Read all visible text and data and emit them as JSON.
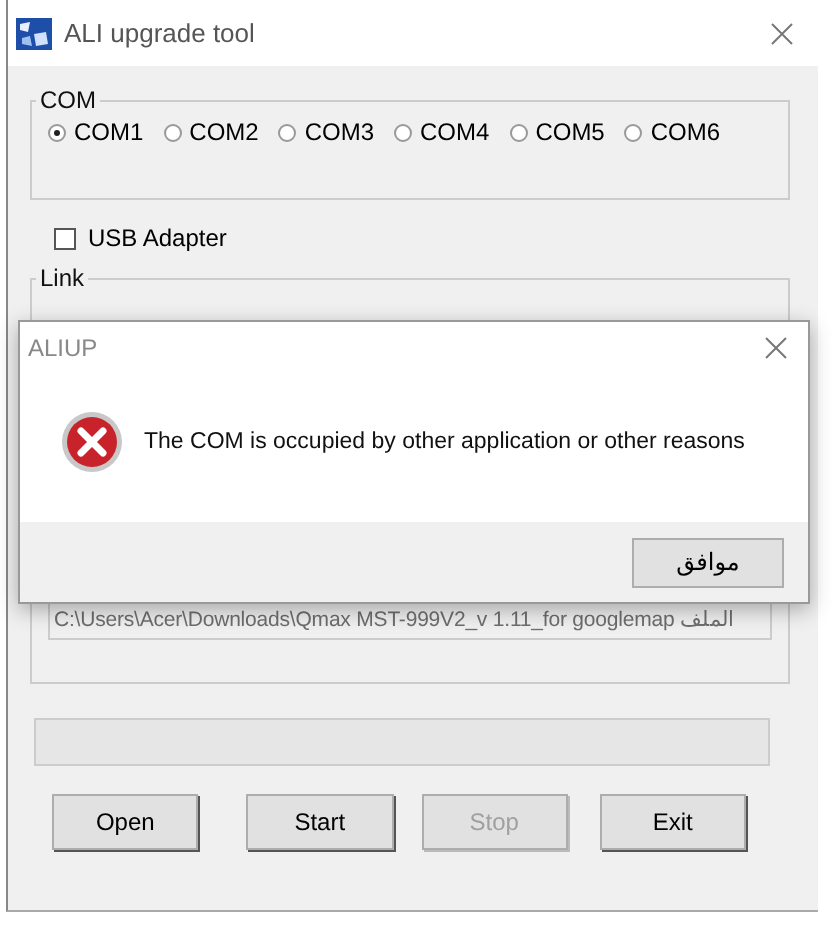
{
  "window": {
    "title": "ALI upgrade tool"
  },
  "com_group": {
    "label": "COM",
    "ports": [
      {
        "label": "COM1",
        "selected": true
      },
      {
        "label": "COM2",
        "selected": false
      },
      {
        "label": "COM3",
        "selected": false
      },
      {
        "label": "COM4",
        "selected": false
      },
      {
        "label": "COM5",
        "selected": false
      },
      {
        "label": "COM6",
        "selected": false
      }
    ]
  },
  "usb_adapter": {
    "label": "USB Adapter",
    "checked": false
  },
  "link_group": {
    "label": "Link",
    "file_path": {
      "value": "C:\\Users\\Acer\\Downloads\\Qmax MST-999V2_v 1.11_for googlemap الملف",
      "disabled": true
    }
  },
  "buttons": [
    {
      "label": "Open",
      "disabled": false
    },
    {
      "label": "Start",
      "disabled": false
    },
    {
      "label": "Stop",
      "disabled": true
    },
    {
      "label": "Exit",
      "disabled": false
    }
  ],
  "dialog": {
    "title": "ALIUP",
    "message": "The COM is occupied by other application or other reasons",
    "button": "موافق"
  }
}
